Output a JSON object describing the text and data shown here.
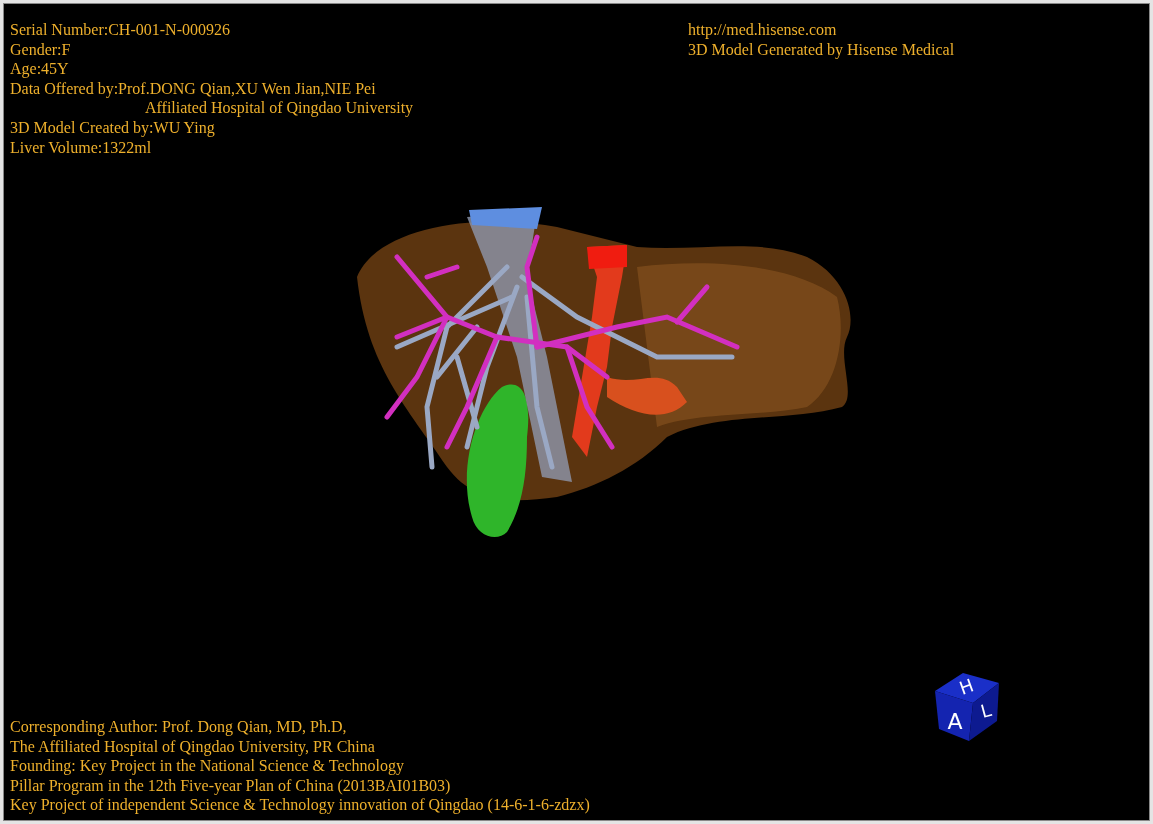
{
  "info_lines": [
    {
      "text": "Serial Number:CH-001-N-000926",
      "indented": false
    },
    {
      "text": "Gender:F",
      "indented": false
    },
    {
      "text": "Age:45Y",
      "indented": false
    },
    {
      "text": "Data Offered by:Prof.DONG Qian,XU Wen Jian,NIE Pei",
      "indented": false
    },
    {
      "text": "Affiliated Hospital of Qingdao University",
      "indented": true
    },
    {
      "text": "3D Model Created by:WU Ying",
      "indented": false
    },
    {
      "text": "Liver Volume:1322ml",
      "indented": false
    }
  ],
  "site_lines": [
    "http://med.hisense.com",
    "3D Model Generated by Hisense Medical"
  ],
  "credit_lines": [
    "Corresponding Author: Prof. Dong Qian, MD, Ph.D,",
    "The Affiliated Hospital of Qingdao University, PR China",
    "Founding: Key Project in the National Science & Technology",
    "Pillar Program in the 12th Five-year Plan of China (2013BAI01B03)",
    "Key Project of independent Science & Technology innovation of Qingdao (14-6-1-6-zdzx)"
  ],
  "orientation_cube": {
    "top": "H",
    "front": "A",
    "side": "L"
  }
}
